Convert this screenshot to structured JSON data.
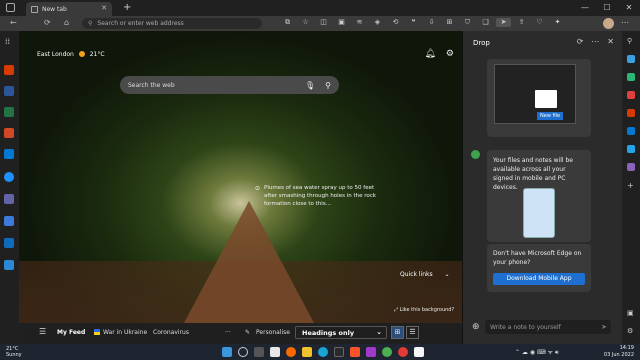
{
  "tab": {
    "title": "New tab",
    "close": "✕",
    "new": "+"
  },
  "window": {
    "minimize": "—",
    "maximize": "☐",
    "close": "✕"
  },
  "toolbar": {
    "back": "←",
    "refresh": "⟳",
    "address_placeholder": "Search or enter web address"
  },
  "newtab": {
    "location": "East London",
    "temperature": "21°C",
    "search_placeholder": "Search the web",
    "caption": "Plumes of sea water spray up to 50 feet after smashing through holes in the rock formation close to this...",
    "quick_links": "Quick links",
    "like_background": "Like this background?"
  },
  "feed": {
    "my_feed": "My Feed",
    "war": "War in Ukraine",
    "coronavirus": "Coronavirus",
    "more": "···",
    "personalise": "Personalise",
    "headings": "Headings only"
  },
  "drop": {
    "title": "Drop",
    "new_file": "New file",
    "files_text": "Your files and notes will be available across all your signed in mobile and PC devices.",
    "no_edge": "Don't have Microsoft Edge on your phone?",
    "download": "Download Mobile App",
    "note_placeholder": "Write a note to yourself"
  },
  "taskbar": {
    "weather_temp": "21°C",
    "weather_desc": "Sunny",
    "time": "14:19",
    "date": "03 Jun 2022"
  },
  "colors": {
    "accent": "#1f6fd0",
    "sun": "#f3a21b"
  }
}
